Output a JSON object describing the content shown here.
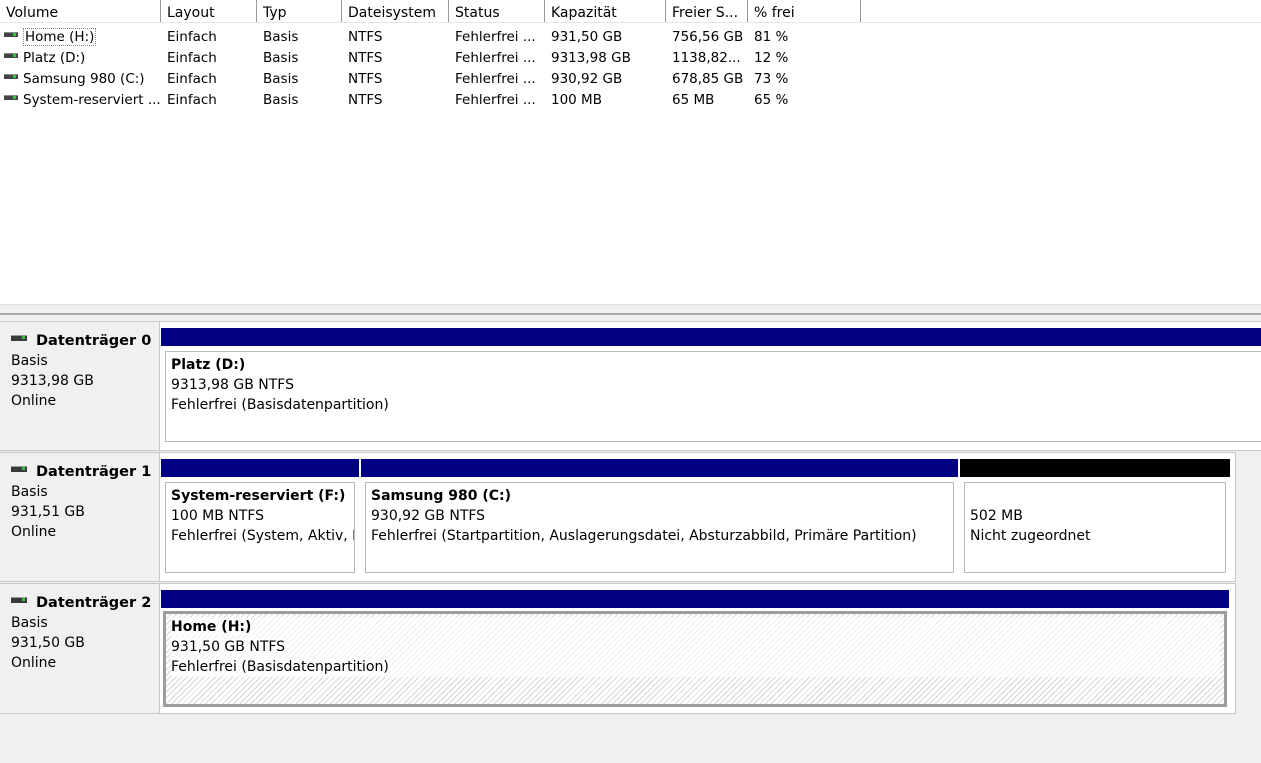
{
  "columns": [
    "Volume",
    "Layout",
    "Typ",
    "Dateisystem",
    "Status",
    "Kapazität",
    "Freier S...",
    "% frei"
  ],
  "volumes": [
    {
      "name": "Home (H:)",
      "layout": "Einfach",
      "type": "Basis",
      "fs": "NTFS",
      "status": "Fehlerfrei ...",
      "capacity": "931,50 GB",
      "free": "756,56 GB",
      "pct": "81 %"
    },
    {
      "name": "Platz (D:)",
      "layout": "Einfach",
      "type": "Basis",
      "fs": "NTFS",
      "status": "Fehlerfrei ...",
      "capacity": "9313,98 GB",
      "free": "1138,82...",
      "pct": "12 %"
    },
    {
      "name": "Samsung 980 (C:)",
      "layout": "Einfach",
      "type": "Basis",
      "fs": "NTFS",
      "status": "Fehlerfrei ...",
      "capacity": "930,92 GB",
      "free": "678,85 GB",
      "pct": "73 %"
    },
    {
      "name": "System-reserviert ...",
      "layout": "Einfach",
      "type": "Basis",
      "fs": "NTFS",
      "status": "Fehlerfrei ...",
      "capacity": "100 MB",
      "free": "65 MB",
      "pct": "65 %"
    }
  ],
  "disks": [
    {
      "title": "Datenträger 0",
      "type": "Basis",
      "size": "9313,98 GB",
      "state": "Online",
      "partitions": [
        {
          "name": "Platz  (D:)",
          "size": "9313,98 GB NTFS",
          "status": "Fehlerfrei (Basisdatenpartition)"
        }
      ]
    },
    {
      "title": "Datenträger 1",
      "type": "Basis",
      "size": "931,51 GB",
      "state": "Online",
      "partitions": [
        {
          "name": "System-reserviert  (F:)",
          "size": "100 MB NTFS",
          "status": "Fehlerfrei (System, Aktiv, Primäre Partition)"
        },
        {
          "name": "Samsung 980  (C:)",
          "size": "930,92 GB NTFS",
          "status": "Fehlerfrei (Startpartition, Auslagerungsdatei, Absturzabbild, Primäre Partition)"
        },
        {
          "name": "",
          "size": "502 MB",
          "status": "Nicht zugeordnet"
        }
      ]
    },
    {
      "title": "Datenträger 2",
      "type": "Basis",
      "size": "931,50 GB",
      "state": "Online",
      "partitions": [
        {
          "name": "Home  (H:)",
          "size": "931,50 GB NTFS",
          "status": "Fehlerfrei (Basisdatenpartition)"
        }
      ]
    }
  ],
  "colors": {
    "primary_partition": "#000080",
    "unallocated": "#000000"
  },
  "icons": {
    "drive": "drive-icon"
  }
}
